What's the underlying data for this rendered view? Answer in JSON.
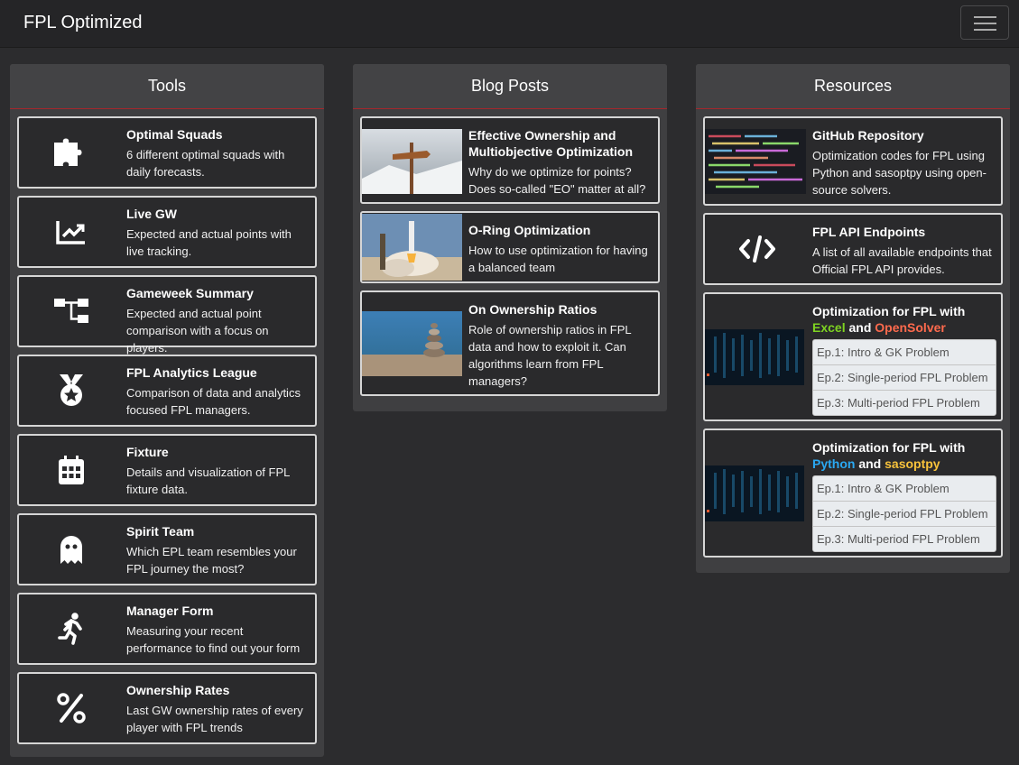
{
  "app": {
    "brand": "FPL Optimized"
  },
  "tools": {
    "header": "Tools",
    "items": [
      {
        "title": "Optimal Squads",
        "desc": "6 different optimal squads with daily forecasts.",
        "icon": "puzzle-icon"
      },
      {
        "title": "Live GW",
        "desc": "Expected and actual points with live tracking.",
        "icon": "chart-line-icon"
      },
      {
        "title": "Gameweek Summary",
        "desc": "Expected and actual point comparison with a focus on players.",
        "icon": "sitemap-icon"
      },
      {
        "title": "FPL Analytics League",
        "desc": "Comparison of data and analytics focused FPL managers.",
        "icon": "medal-icon"
      },
      {
        "title": "Fixture",
        "desc": "Details and visualization of FPL fixture data.",
        "icon": "calendar-icon"
      },
      {
        "title": "Spirit Team",
        "desc": "Which EPL team resembles your FPL journey the most?",
        "icon": "ghost-icon"
      },
      {
        "title": "Manager Form",
        "desc": "Measuring your recent performance to find out your form",
        "icon": "running-icon"
      },
      {
        "title": "Ownership Rates",
        "desc": "Last GW ownership rates of every player with FPL trends",
        "icon": "percent-icon"
      }
    ]
  },
  "blog": {
    "header": "Blog Posts",
    "items": [
      {
        "title": "Effective Ownership and Multiobjective Optimization",
        "desc": "Why do we optimize for points? Does so-called \"EO\" matter at all?"
      },
      {
        "title": "O-Ring Optimization",
        "desc": "How to use optimization for having a balanced team"
      },
      {
        "title": "On Ownership Ratios",
        "desc": "Role of ownership ratios in FPL data and how to exploit it. Can algorithms learn from FPL managers?"
      }
    ]
  },
  "resources": {
    "header": "Resources",
    "github": {
      "title": "GitHub Repository",
      "desc": "Optimization codes for FPL using Python and sasoptpy using open-source solvers."
    },
    "api": {
      "title": "FPL API Endpoints",
      "desc": "A list of all available endpoints that Official FPL API provides.",
      "icon": "code-icon"
    },
    "excel": {
      "title_prefix": "Optimization for FPL with",
      "tool1": "Excel",
      "and": "and",
      "tool2": "OpenSolver",
      "episodes": [
        "Ep.1: Intro & GK Problem",
        "Ep.2: Single-period FPL Problem",
        "Ep.3: Multi-period FPL Problem"
      ]
    },
    "python": {
      "title_prefix": "Optimization for FPL with",
      "tool1": "Python",
      "and": "and",
      "tool2": "sasoptpy",
      "episodes": [
        "Ep.1: Intro & GK Problem",
        "Ep.2: Single-period FPL Problem",
        "Ep.3: Multi-period FPL Problem"
      ]
    }
  },
  "colors": {
    "header_divider": "#a6262c",
    "excel": "#7ed321",
    "opensolver": "#ff6a4d",
    "python": "#2aa8f2",
    "sasoptpy": "#f7c23b"
  }
}
